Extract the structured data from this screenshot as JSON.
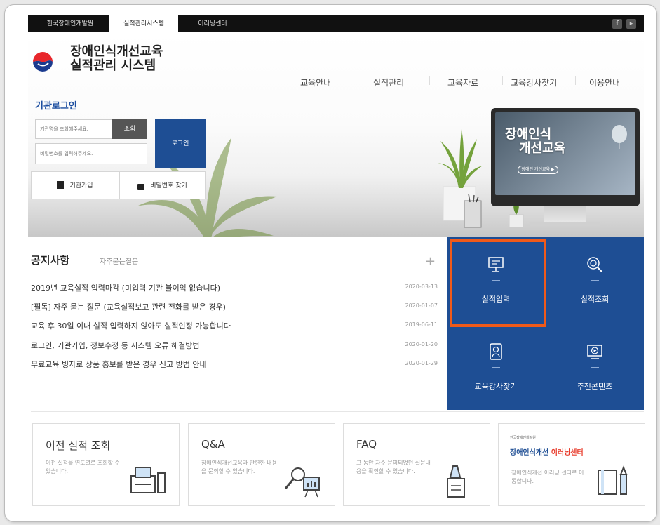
{
  "topbar": {
    "tabs": [
      "한국장애인개발원",
      "실적관리시스템",
      "이러닝센터"
    ],
    "social": [
      "facebook-icon",
      "youtube-icon"
    ]
  },
  "header": {
    "title_line1": "장애인식개선교육",
    "title_line2": "실적관리 시스템",
    "nav": [
      "교육안내",
      "실적관리",
      "교육자료",
      "교육강사찾기",
      "이용안내"
    ]
  },
  "login": {
    "title": "기관로그인",
    "org_placeholder": "기관명을 조회해주세요.",
    "search_btn": "조회",
    "pw_placeholder": "비밀번호를 입력해주세요.",
    "login_btn": "로그인",
    "join_btn": "기관가입",
    "find_pw_btn": "비밀번호 찾기"
  },
  "hero": {
    "screen_title_line1": "장애인식",
    "screen_title_line2": "개선교육",
    "screen_button": "장애인 개선교육 ▶"
  },
  "notices": {
    "tab_active": "공지사항",
    "tab_other": "자주묻는질문",
    "more": "+",
    "items": [
      {
        "title": "2019년 교육실적 입력마감 (미입력 기관 불이익 없습니다)",
        "date": "2020-03-13"
      },
      {
        "title": "[필독] 자주 묻는 질문 (교육실적보고 관련 전화를 받은 경우)",
        "date": "2020-01-07"
      },
      {
        "title": "교육 후 30일 이내 실적 입력하지 않아도 실적인정 가능합니다",
        "date": "2019-06-11"
      },
      {
        "title": "로그인, 기관가입, 정보수정 등 시스템 오류 해결방법",
        "date": "2020-01-20"
      },
      {
        "title": "무료교육 빙자로 상품 홍보를 받은 경우 신고 방법 안내",
        "date": "2020-01-29"
      }
    ]
  },
  "tiles": [
    {
      "label": "실적입력",
      "icon": "monitor-icon"
    },
    {
      "label": "실적조회",
      "icon": "search-icon"
    },
    {
      "label": "교육강사찾기",
      "icon": "badge-icon"
    },
    {
      "label": "추천콘텐츠",
      "icon": "play-icon"
    }
  ],
  "cards": [
    {
      "title": "이전 실적 조회",
      "desc": "이전 실적을 연도별로 조회할 수 있습니다.",
      "icon": "printer-icon"
    },
    {
      "title": "Q&A",
      "desc": "장애인식개선교육과 관련한 내용을 문의할 수 있습니다.",
      "icon": "magnifier-chart-icon"
    },
    {
      "title": "FAQ",
      "desc": "그 동안 자주 문의되었던 질문내용을 확인할 수 있습니다.",
      "icon": "document-pen-icon"
    },
    {
      "title": "",
      "desc": "장애인식개선 이러닝 센터로 이동합니다.",
      "icon": "notebook-icon",
      "logo_small": "한국장애인개발원",
      "logo_main_a": "장애인식개선",
      "logo_main_b": "이러닝센터"
    }
  ],
  "colors": {
    "brand_blue": "#1e4e94",
    "highlight": "#f05a1a",
    "dark_bar": "#111111"
  }
}
